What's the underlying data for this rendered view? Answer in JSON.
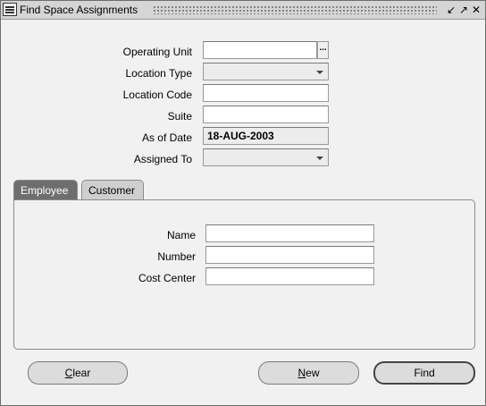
{
  "window": {
    "title": "Find Space Assignments",
    "controls": [
      "minimize-icon",
      "maximize-icon",
      "close-icon"
    ]
  },
  "form": {
    "operating_unit": {
      "label": "Operating Unit",
      "value": ""
    },
    "location_type": {
      "label": "Location Type",
      "value": ""
    },
    "location_code": {
      "label": "Location Code",
      "value": ""
    },
    "suite": {
      "label": "Suite",
      "value": ""
    },
    "as_of_date": {
      "label": "As of Date",
      "value": "18-AUG-2003"
    },
    "assigned_to": {
      "label": "Assigned To",
      "value": ""
    }
  },
  "tabs": [
    {
      "label": "Employee",
      "active": true
    },
    {
      "label": "Customer",
      "active": false
    }
  ],
  "employee": {
    "name": {
      "label": "Name",
      "value": ""
    },
    "number": {
      "label": "Number",
      "value": ""
    },
    "cost_center": {
      "label": "Cost Center",
      "value": ""
    }
  },
  "buttons": {
    "clear": {
      "label": "Clear",
      "mnemonic": "C",
      "rest": "lear"
    },
    "new": {
      "label": "New",
      "mnemonic": "N",
      "rest": "ew"
    },
    "find": {
      "label": "Find"
    }
  },
  "lov_glyph": "...",
  "colors": {
    "active_tab": "#6e6e6e",
    "window_bg": "#f1f1f1"
  }
}
